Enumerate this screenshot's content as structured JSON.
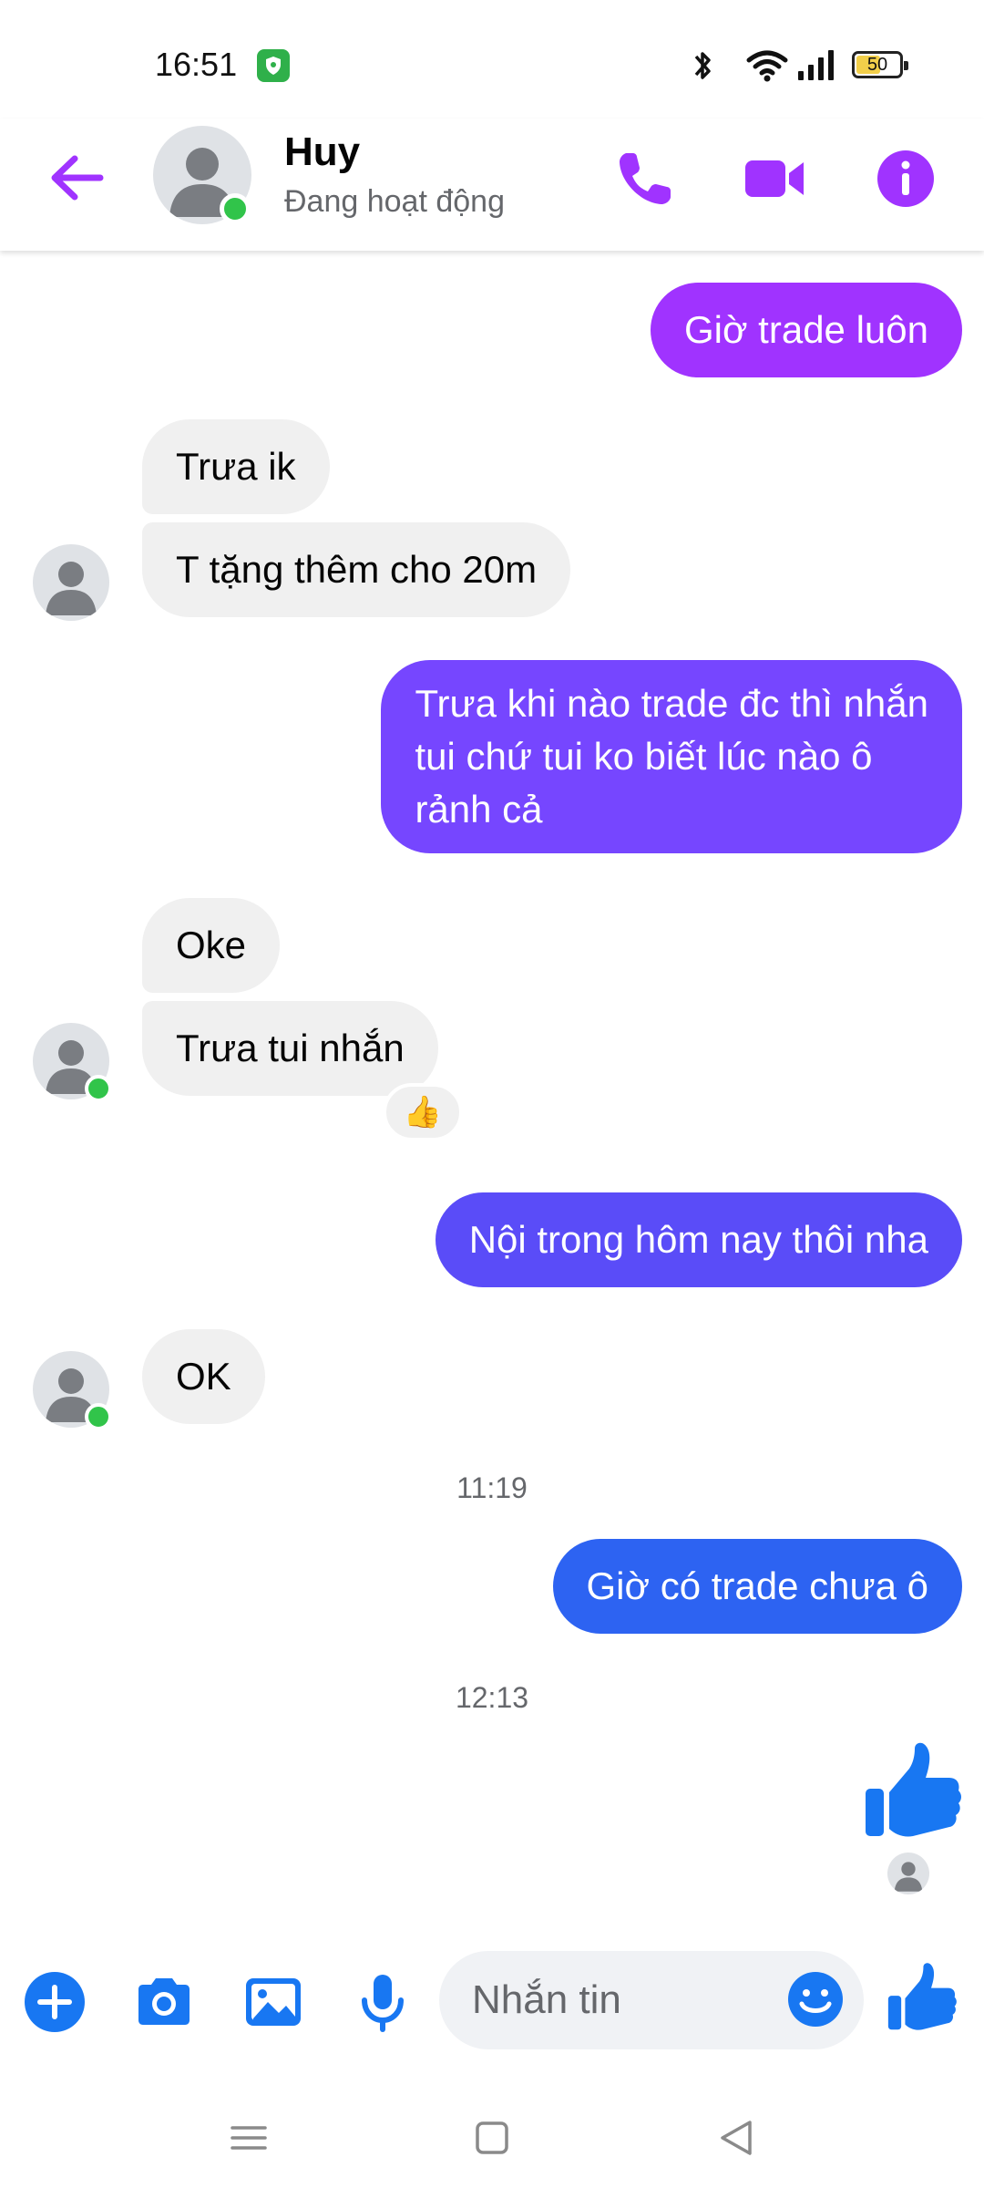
{
  "status_bar": {
    "time": "16:51",
    "battery": "50"
  },
  "header": {
    "name": "Huy",
    "status": "Đang hoạt động"
  },
  "messages": [
    {
      "side": "out",
      "text": "Giờ trade luôn"
    },
    {
      "side": "in",
      "text": "Trưa ik"
    },
    {
      "side": "in",
      "text": "T tặng thêm cho 20m"
    },
    {
      "side": "out",
      "text_lines": [
        "Trưa khi nào trade đc thì nhắn",
        "tui chứ tui ko biết lúc nào ô",
        "rảnh cả"
      ]
    },
    {
      "side": "in",
      "text": "Oke"
    },
    {
      "side": "in",
      "text": "Trưa tui nhắn",
      "reaction": "👍"
    },
    {
      "side": "out",
      "text": "Nội trong hôm nay thôi nha"
    },
    {
      "side": "in",
      "text": "OK"
    },
    {
      "type": "timestamp",
      "text": "11:19"
    },
    {
      "side": "out",
      "text": "Giờ có trade chưa ô"
    },
    {
      "type": "timestamp",
      "text": "12:13"
    },
    {
      "side": "out",
      "type": "like-sticker"
    }
  ],
  "composer": {
    "placeholder": "Nhắn tin"
  },
  "colors": {
    "purple": "#a033ff",
    "violet": "#7646ff",
    "indigo": "#5a4cf8",
    "blue": "#2d63f2",
    "like_blue": "#1877f2",
    "incoming": "#f0f0f0",
    "online": "#31c44a"
  }
}
